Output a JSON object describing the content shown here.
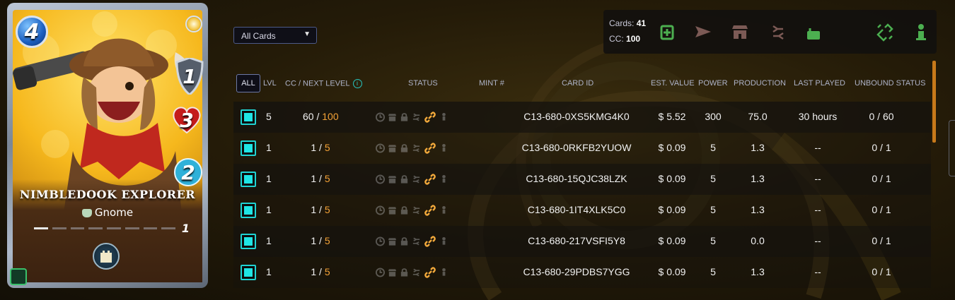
{
  "card": {
    "name": "NIMBLEDOOK EXPLORER",
    "mana": "4",
    "attack": "1",
    "health": "3",
    "speed": "2",
    "race": "Gnome",
    "level": "1",
    "level_progress": 1,
    "level_total": 8
  },
  "filter": {
    "selected": "All Cards"
  },
  "summary": {
    "cards_label": "Cards:",
    "cards_value": "41",
    "cc_label": "CC:",
    "cc_value": "100"
  },
  "actions": [
    {
      "icon": "add-card-icon",
      "color": "#4caf50"
    },
    {
      "icon": "send-icon",
      "color": "#7c5a55"
    },
    {
      "icon": "market-icon",
      "color": "#7c5a55"
    },
    {
      "icon": "transfer-icon",
      "color": "#7c5a55"
    },
    {
      "icon": "lock-icon",
      "color": "#4caf50"
    },
    {
      "icon": "burn-icon",
      "color": "#7c5a55"
    },
    {
      "icon": "unlink-icon",
      "color": "#4caf50"
    },
    {
      "icon": "delegate-icon",
      "color": "#4caf50"
    }
  ],
  "table": {
    "all_label": "ALL",
    "headers": {
      "lvl": "LVL",
      "cc_next": "CC / NEXT LEVEL",
      "status": "STATUS",
      "mint": "MINT #",
      "card_id": "CARD ID",
      "est_value": "EST. VALUE",
      "power": "POWER",
      "production": "PRODUCTION",
      "last_played": "LAST PLAYED",
      "unbound": "UNBOUND STATUS"
    },
    "rows": [
      {
        "lvl": "5",
        "cc": "60",
        "next": "100",
        "mint": "",
        "card_id": "C13-680-0XS5KMG4K0",
        "value": "$ 5.52",
        "power": "300",
        "production": "75.0",
        "last_played": "30 hours",
        "unbound": "0 / 60"
      },
      {
        "lvl": "1",
        "cc": "1",
        "next": "5",
        "mint": "",
        "card_id": "C13-680-0RKFB2YUOW",
        "value": "$ 0.09",
        "power": "5",
        "production": "1.3",
        "last_played": "--",
        "unbound": "0 / 1"
      },
      {
        "lvl": "1",
        "cc": "1",
        "next": "5",
        "mint": "",
        "card_id": "C13-680-15QJC38LZK",
        "value": "$ 0.09",
        "power": "5",
        "production": "1.3",
        "last_played": "--",
        "unbound": "0 / 1"
      },
      {
        "lvl": "1",
        "cc": "1",
        "next": "5",
        "mint": "",
        "card_id": "C13-680-1IT4XLK5C0",
        "value": "$ 0.09",
        "power": "5",
        "production": "1.3",
        "last_played": "--",
        "unbound": "0 / 1"
      },
      {
        "lvl": "1",
        "cc": "1",
        "next": "5",
        "mint": "",
        "card_id": "C13-680-217VSFI5Y8",
        "value": "$ 0.09",
        "power": "5",
        "production": "0.0",
        "last_played": "--",
        "unbound": "0 / 1"
      },
      {
        "lvl": "1",
        "cc": "1",
        "next": "5",
        "mint": "",
        "card_id": "C13-680-29PDBS7YGG",
        "value": "$ 0.09",
        "power": "5",
        "production": "1.3",
        "last_played": "--",
        "unbound": "0 / 1"
      }
    ]
  }
}
